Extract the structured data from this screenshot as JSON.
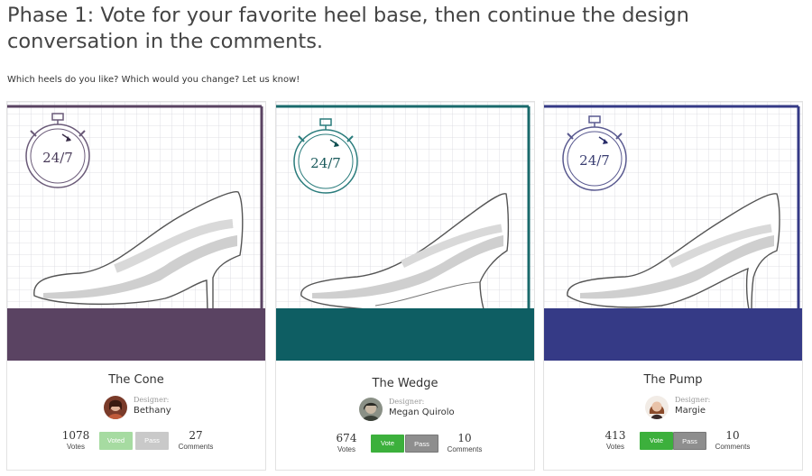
{
  "page": {
    "title": "Phase 1: Vote for your favorite heel base, then continue the design conversation in the comments.",
    "subtitle": "Which heels do you like? Which would you change? Let us know!"
  },
  "colors": {
    "cone": "#5a4362",
    "wedge": "#0e5e63",
    "pump": "#353a86"
  },
  "cards": [
    {
      "name": "The Cone",
      "designer_label": "Designer:",
      "designer": "Bethany",
      "votes": "1078",
      "votes_label": "Votes",
      "vote_button": "Voted",
      "pass_button": "Pass",
      "comments": "27",
      "comments_label": "Comments",
      "badge_text": "24/7",
      "icon": "stopwatch-icon"
    },
    {
      "name": "The Wedge",
      "designer_label": "Designer:",
      "designer": "Megan Quirolo",
      "votes": "674",
      "votes_label": "Votes",
      "vote_button": "Vote",
      "pass_button": "Pass",
      "comments": "10",
      "comments_label": "Comments",
      "badge_text": "24/7",
      "icon": "stopwatch-icon"
    },
    {
      "name": "The Pump",
      "designer_label": "Designer:",
      "designer": "Margie",
      "votes": "413",
      "votes_label": "Votes",
      "vote_button": "Vote",
      "pass_button": "Pass",
      "comments": "10",
      "comments_label": "Comments",
      "badge_text": "24/7",
      "icon": "stopwatch-icon"
    }
  ]
}
